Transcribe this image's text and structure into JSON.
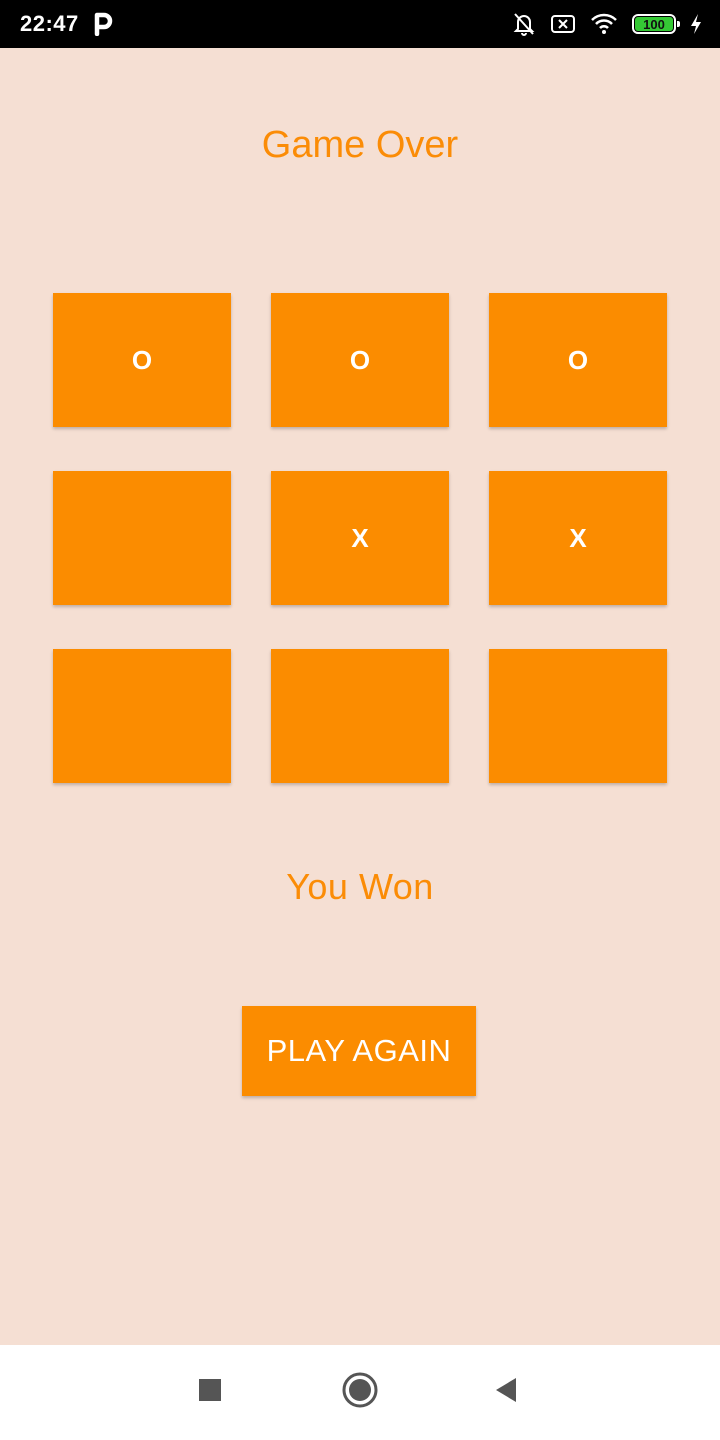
{
  "status_bar": {
    "time": "22:47",
    "battery_level": "100",
    "icons": [
      "parking-icon",
      "bell-off-icon",
      "sim-off-icon",
      "wifi-icon",
      "battery-icon",
      "charging-icon"
    ],
    "battery_color": "#35c935"
  },
  "screen": {
    "title": "Game Over",
    "result": "You Won",
    "play_again_label": "PLAY AGAIN"
  },
  "board": {
    "cells": [
      "O",
      "O",
      "O",
      "",
      "X",
      "X",
      "",
      "",
      ""
    ]
  },
  "colors": {
    "background": "#f5dfd3",
    "accent": "#fb8c00",
    "text_accent": "#fb8c06",
    "cell_text": "#ffffff"
  },
  "nav_bar": {
    "icons": [
      "recent-apps-icon",
      "home-icon",
      "back-icon"
    ]
  }
}
